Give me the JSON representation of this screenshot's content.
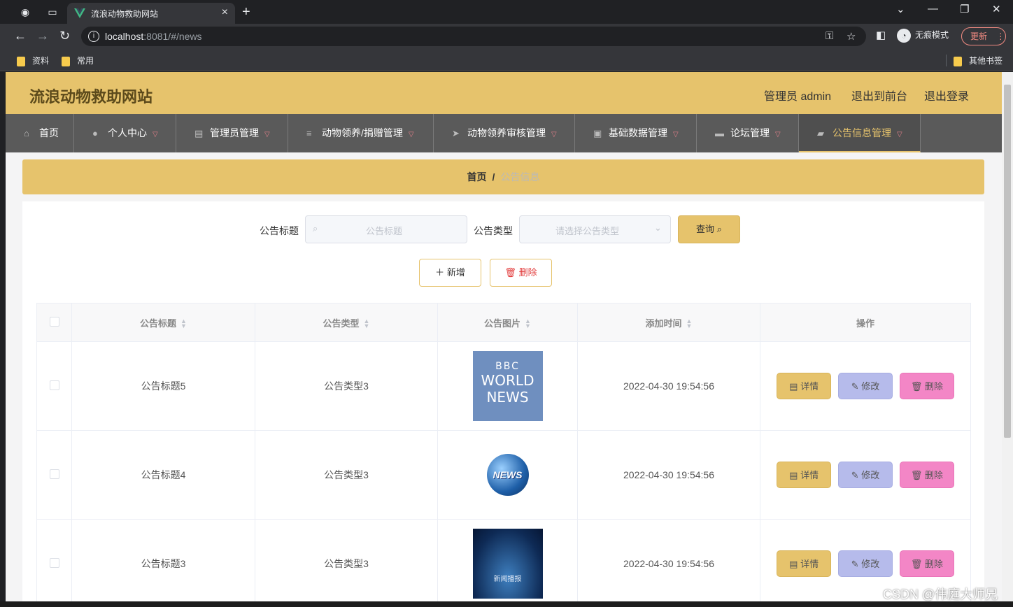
{
  "browser": {
    "tab_title": "流浪动物救助网站",
    "url_host": "localhost",
    "url_rest": ":8081/#/news",
    "incognito_label": "无痕模式",
    "update_label": "更新",
    "bookmarks": [
      "资料",
      "常用"
    ],
    "other_bookmarks": "其他书签",
    "icons": {
      "tab_close": "×",
      "new_tab": "+",
      "back": "←",
      "forward": "→",
      "reload": "↻",
      "key": "🔑",
      "star": "☆",
      "menu": "⋮",
      "minimize": "—",
      "restore": "❐",
      "close": "✕",
      "dropdown": "⌄"
    }
  },
  "site": {
    "title": "流浪动物救助网站",
    "header_links": [
      "管理员 admin",
      "退出到前台",
      "退出登录"
    ]
  },
  "menu": [
    {
      "label": "首页",
      "icon": "home-icon",
      "glyph": "⌂"
    },
    {
      "label": "个人中心",
      "icon": "user-icon",
      "glyph": "●"
    },
    {
      "label": "管理员管理",
      "icon": "clipboard-icon",
      "glyph": "▤"
    },
    {
      "label": "动物领养/捐赠管理",
      "icon": "sliders-icon",
      "glyph": "≡"
    },
    {
      "label": "动物领养审核管理",
      "icon": "send-icon",
      "glyph": "➤"
    },
    {
      "label": "基础数据管理",
      "icon": "document-icon",
      "glyph": "▣"
    },
    {
      "label": "论坛管理",
      "icon": "briefcase-icon",
      "glyph": "▬"
    },
    {
      "label": "公告信息管理",
      "icon": "comment-icon",
      "glyph": "▰"
    }
  ],
  "breadcrumb": {
    "home": "首页",
    "separator": "/",
    "current": "公告信息"
  },
  "search": {
    "title_label": "公告标题",
    "title_placeholder": "公告标题",
    "type_label": "公告类型",
    "type_placeholder": "请选择公告类型",
    "query_button": "查询"
  },
  "actions": {
    "add": "新增",
    "delete": "删除"
  },
  "table": {
    "columns": [
      "公告标题",
      "公告类型",
      "公告图片",
      "添加时间",
      "操作"
    ],
    "rows": [
      {
        "title": "公告标题5",
        "type": "公告类型3",
        "image": "bbc-world-news",
        "image_text": [
          "BBC",
          "WORLD",
          "NEWS"
        ],
        "time": "2022-04-30 19:54:56"
      },
      {
        "title": "公告标题4",
        "type": "公告类型3",
        "image": "news-globe",
        "image_text": [
          "NEWS"
        ],
        "time": "2022-04-30 19:54:56"
      },
      {
        "title": "公告标题3",
        "type": "公告类型3",
        "image": "news-broadcast-stage",
        "image_text": [
          "新闻播报"
        ],
        "time": "2022-04-30 19:54:56"
      }
    ],
    "row_buttons": {
      "detail": "详情",
      "edit": "修改",
      "delete": "删除"
    }
  },
  "watermark": "CSDN @伟庭大师兄"
}
